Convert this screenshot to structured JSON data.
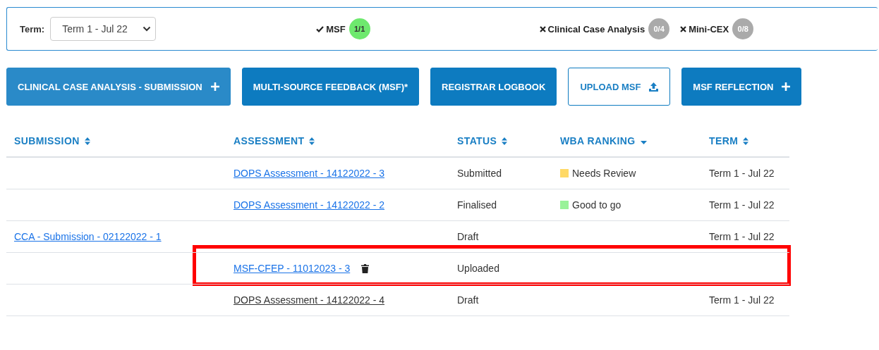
{
  "filter_bar": {
    "term_label": "Term:",
    "term_select": {
      "value": "Term 1 - Jul 22"
    },
    "requirements": [
      {
        "label": "MSF",
        "done": true,
        "count": "1/1"
      },
      {
        "label": "Clinical Case Analysis",
        "done": false,
        "count": "0/4"
      },
      {
        "label": "Mini-CEX",
        "done": false,
        "count": "0/8"
      }
    ]
  },
  "actions": [
    {
      "label": "CLINICAL CASE ANALYSIS - SUBMISSION",
      "kind": "add",
      "hover": true
    },
    {
      "label": "MULTI-SOURCE FEEDBACK (MSF)*",
      "kind": "plain",
      "hover": false
    },
    {
      "label": "REGISTRAR LOGBOOK",
      "kind": "plain",
      "hover": false
    },
    {
      "label": "UPLOAD MSF",
      "kind": "upload",
      "hover": false
    },
    {
      "label": "MSF REFLECTION",
      "kind": "add",
      "hover": false
    }
  ],
  "table": {
    "columns": [
      {
        "label": "SUBMISSION",
        "sorted": false
      },
      {
        "label": "ASSESSMENT",
        "sorted": false
      },
      {
        "label": "STATUS",
        "sorted": false
      },
      {
        "label": "WBA RANKING",
        "sorted": true
      },
      {
        "label": "TERM",
        "sorted": false
      }
    ],
    "rows": [
      {
        "submission": null,
        "assessment": {
          "text": "DOPS Assessment - 14122022 - 3",
          "visited": false
        },
        "deletable": false,
        "status": "Submitted",
        "ranking": {
          "text": "Needs Review",
          "color": "#ffd966"
        },
        "term": "Term 1 - Jul 22",
        "highlighted": false
      },
      {
        "submission": null,
        "assessment": {
          "text": "DOPS Assessment - 14122022 - 2",
          "visited": false
        },
        "deletable": false,
        "status": "Finalised",
        "ranking": {
          "text": "Good to go",
          "color": "#99f299"
        },
        "term": "Term 1 - Jul 22",
        "highlighted": false
      },
      {
        "submission": {
          "text": "CCA - Submission - 02122022 - 1",
          "visited": false
        },
        "assessment": null,
        "deletable": false,
        "status": "Draft",
        "ranking": null,
        "term": "Term 1 - Jul 22",
        "highlighted": false
      },
      {
        "submission": null,
        "assessment": {
          "text": "MSF-CFEP - 11012023 - 3",
          "visited": false
        },
        "deletable": true,
        "status": "Uploaded",
        "ranking": null,
        "term": null,
        "highlighted": true
      },
      {
        "submission": null,
        "assessment": {
          "text": "DOPS Assessment - 14122022 - 4",
          "visited": true
        },
        "deletable": false,
        "status": "Draft",
        "ranking": null,
        "term": "Term 1 - Jul 22",
        "highlighted": false
      }
    ]
  }
}
